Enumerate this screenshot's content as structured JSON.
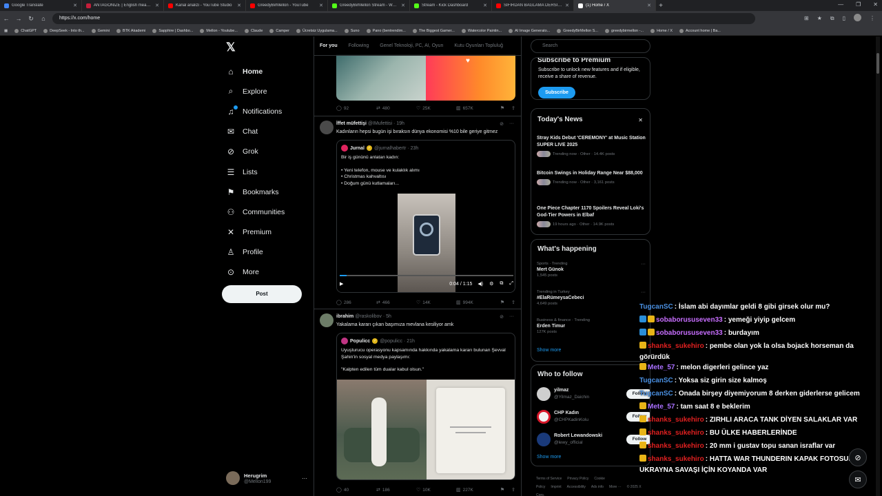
{
  "browser": {
    "tabs": [
      {
        "title": "Google Translate",
        "color": "#4285f4",
        "active": false
      },
      {
        "title": "ANTAGONIZE | English meaning",
        "color": "#c41e3a",
        "active": false
      },
      {
        "title": "Kanal analizi - YouTube Studio",
        "color": "#ff0000",
        "active": false
      },
      {
        "title": "GreedyBirMellon - YouTube",
        "color": "#ff0000",
        "active": false
      },
      {
        "title": "GreedyBirMellon Stream - Watch",
        "color": "#53fc18",
        "active": false
      },
      {
        "title": "Stream - Kick Dashboard",
        "color": "#53fc18",
        "active": false
      },
      {
        "title": "SIFIRDAN BAĞLAMA DERSİ 3 (EN",
        "color": "#ff0000",
        "active": false
      },
      {
        "title": "(1) Home / X",
        "color": "#ffffff",
        "active": true
      }
    ],
    "url": "https://x.com/home",
    "bookmarks": [
      "ChatGPT",
      "DeepSeek - Into th...",
      "Gemini",
      "BTK Akademi",
      "Sapphire | Dashbo...",
      "Mellon - Youtube...",
      "Claude",
      "Camper",
      "Ücretsiz Uygulama...",
      "Suno",
      "Pano (bentrendim...",
      "The Biggest Gamer...",
      "Watercolor Paintin...",
      "AI Image Generato...",
      "GreedyBirMellon S...",
      "greedybirmellon -...",
      "Home / X",
      "Account home | Ba..."
    ]
  },
  "nav": {
    "items": [
      {
        "label": "Home",
        "icon": "home-icon",
        "glyph": "⌂"
      },
      {
        "label": "Explore",
        "icon": "search-icon",
        "glyph": "⌕"
      },
      {
        "label": "Notifications",
        "icon": "bell-icon",
        "glyph": "♫"
      },
      {
        "label": "Chat",
        "icon": "mail-icon",
        "glyph": "✉"
      },
      {
        "label": "Grok",
        "icon": "grok-icon",
        "glyph": "⊘"
      },
      {
        "label": "Lists",
        "icon": "list-icon",
        "glyph": "☰"
      },
      {
        "label": "Bookmarks",
        "icon": "bookmark-icon",
        "glyph": "⚑"
      },
      {
        "label": "Communities",
        "icon": "people-icon",
        "glyph": "⚇"
      },
      {
        "label": "Premium",
        "icon": "x-logo-icon",
        "glyph": "✕"
      },
      {
        "label": "Profile",
        "icon": "person-icon",
        "glyph": "♙"
      },
      {
        "label": "More",
        "icon": "more-circle-icon",
        "glyph": "⊙"
      }
    ],
    "post_label": "Post",
    "account": {
      "name": "Herugrim",
      "handle": "@Mellon199"
    }
  },
  "feed": {
    "tabs": [
      "For you",
      "Following",
      "Genel Teknoloji, PC, AI, Oyun",
      "Kutu Oyunları Topluluğ"
    ],
    "tweet0_actions": {
      "replies": "92",
      "reposts": "480",
      "likes": "25K",
      "views": "657K"
    },
    "tweet1": {
      "name": "İffet müfettişi",
      "handle": "@IMufettisi · 19h",
      "text": "Kadınların hepsi bugün işi bıraksın dünya ekonomisi %10 bile geriye gitmez",
      "quote": {
        "name": "Jurnal",
        "handle": "@jurnalhabertr · 23h",
        "lines": [
          "Bir iş gününü anlatan kadın:",
          "",
          "• Yeni telefon, mouse ve kulaklık alımı",
          "• Christmas kahvaltısı",
          "• Doğum günü kutlamaları..."
        ],
        "video_time": "0:04 / 1:15",
        "video_progress": 0.04
      },
      "actions": {
        "replies": "286",
        "reposts": "466",
        "likes": "14K",
        "views": "994K"
      }
    },
    "tweet2": {
      "name": "ibrahim",
      "handle": "@raskolibov · 5h",
      "text": "Yakalama kararı çıkan başımıza mevlana kesiliyor amk",
      "quote": {
        "name": "Populicc",
        "handle": "@populicc · 21h",
        "lines": [
          "Uyuşturucu operasyonu kapsamında hakkında yakalama kararı bulunan Şevval Şahin'in sosyal medya paylaşımı:",
          "",
          "\"Kalpten edilen tüm dualar kabul olsun.\""
        ]
      },
      "actions": {
        "replies": "40",
        "reposts": "186",
        "likes": "10K",
        "views": "227K"
      }
    }
  },
  "right": {
    "search_placeholder": "Search",
    "premium": {
      "title": "Subscribe to Premium",
      "text": "Subscribe to unlock new features and if eligible, receive a share of revenue.",
      "button": "Subscribe"
    },
    "news": {
      "title": "Today's News",
      "items": [
        {
          "headline": "Stray Kids Debut 'CEREMONY' at Music Station SUPER LIVE 2025",
          "meta": "Trending now · Other · 14.4K posts"
        },
        {
          "headline": "Bitcoin Swings in Holiday Range Near $88,000",
          "meta": "Trending now · Other · 3,161 posts"
        },
        {
          "headline": "One Piece Chapter 1170 Spoilers Reveal Loki's God-Tier Powers in Elbaf",
          "meta": "19 hours ago · Other · 14.9K posts"
        }
      ]
    },
    "happening": {
      "title": "What's happening",
      "items": [
        {
          "context": "Sports · Trending",
          "topic": "Mert Günok",
          "count": "1,545 posts"
        },
        {
          "context": "Trending in Turkey",
          "topic": "#ElaRümeysaCebeci",
          "count": "4,649 posts"
        },
        {
          "context": "Business & finance · Trending",
          "topic": "Erden Timur",
          "count": "127K posts"
        }
      ],
      "show_more": "Show more"
    },
    "who": {
      "title": "Who to follow",
      "items": [
        {
          "name": "yilmaz",
          "handle": "@Yilmaz_Daichin",
          "button": "Follow"
        },
        {
          "name": "CHP Kadın",
          "handle": "@CHPKadinKolu",
          "button": "Follow"
        },
        {
          "name": "Robert Lewandowski",
          "handle": "@lewy_official",
          "button": "Follow"
        }
      ],
      "show_more": "Show more"
    },
    "footer": [
      "Terms of Service",
      "Privacy Policy",
      "Cookie Policy",
      "Imprint",
      "Accessibility",
      "Ads info",
      "More ···",
      "© 2025 X Corp."
    ]
  },
  "chat": [
    {
      "user": "TugcanSC",
      "color": "#4a90e2",
      "badges": [],
      "text": ": İslam abi dayımlar geldi 8 gibi girsek olur mu?"
    },
    {
      "user": "sobaborususeven33",
      "color": "#c86eff",
      "badges": [
        "pr",
        "cr"
      ],
      "text": ": yemeği yiyip gelcem"
    },
    {
      "user": "sobaborususeven33",
      "color": "#c86eff",
      "badges": [
        "pr",
        "cr"
      ],
      "text": ": burdayım"
    },
    {
      "user": "shanks_sukehiro",
      "color": "#e02020",
      "badges": [
        "cr"
      ],
      "text": ": pembe olan yok la olsa bojack horseman da görürdük"
    },
    {
      "user": "Mete_57",
      "color": "#a970ff",
      "badges": [
        "cr"
      ],
      "text": ": melon digerleri gelince yaz"
    },
    {
      "user": "TugcanSC",
      "color": "#4a90e2",
      "badges": [],
      "text": ": Yoksa siz girin size kalmoş"
    },
    {
      "user": "TugcanSC",
      "color": "#4a90e2",
      "badges": [],
      "text": ": Onada birşey diyemiyorum 8 derken giderlerse gelicem"
    },
    {
      "user": "Mete_57",
      "color": "#a970ff",
      "badges": [
        "cr"
      ],
      "text": ": tam saat 8 e beklerim"
    },
    {
      "user": "shanks_sukehiro",
      "color": "#e02020",
      "badges": [
        "cr"
      ],
      "text": ": ZIRHLI ARACA TANK DİYEN SALAKLAR VAR"
    },
    {
      "user": "shanks_sukehiro",
      "color": "#e02020",
      "badges": [
        "cr"
      ],
      "text": ": BU ÜLKE HABERLERİNDE"
    },
    {
      "user": "shanks_sukehiro",
      "color": "#e02020",
      "badges": [
        "cr"
      ],
      "text": ": 20 mm i gustav topu sanan israflar var"
    },
    {
      "user": "shanks_sukehiro",
      "color": "#e02020",
      "badges": [
        "cr"
      ],
      "text": ": HATTA WAR THUNDERIN KAPAK FOTOSUNU UKRAYNA SAVAŞI İÇİN KOYANDA VAR"
    }
  ]
}
